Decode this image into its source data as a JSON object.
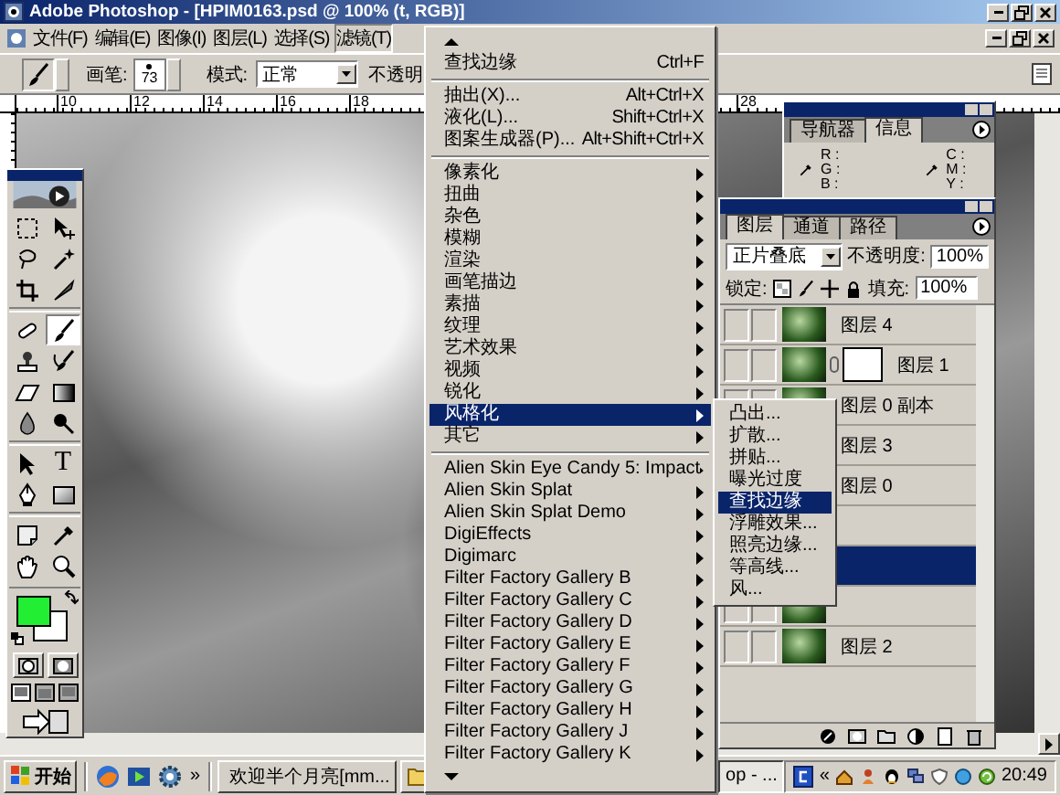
{
  "window": {
    "title": "Adobe Photoshop - [HPIM0163.psd @ 100% (t, RGB)]"
  },
  "menu_bar": [
    {
      "label": "文件(F)",
      "selected": false
    },
    {
      "label": "编辑(E)",
      "selected": false
    },
    {
      "label": "图像(I)",
      "selected": false
    },
    {
      "label": "图层(L)",
      "selected": false
    },
    {
      "label": "选择(S)",
      "selected": false
    },
    {
      "label": "滤镜(T)",
      "selected": true
    }
  ],
  "options_bar": {
    "brush_label": "画笔:",
    "brush_size": "73",
    "mode_label": "模式:",
    "mode_value": "正常",
    "opacity_label": "不透明"
  },
  "ruler": {
    "marks": [
      "10",
      "12",
      "14",
      "16",
      "18"
    ],
    "marks_after_menu": [
      "28"
    ]
  },
  "toolbox": {
    "tools": [
      {
        "kind": "marquee",
        "selected": false
      },
      {
        "kind": "move",
        "selected": false
      },
      {
        "kind": "lasso",
        "selected": false
      },
      {
        "kind": "wand",
        "selected": false
      },
      {
        "kind": "crop",
        "selected": false
      },
      {
        "kind": "slice",
        "selected": false
      },
      {
        "kind": "separator"
      },
      {
        "kind": "healing",
        "selected": false
      },
      {
        "kind": "brush",
        "selected": true
      },
      {
        "kind": "stamp",
        "selected": false
      },
      {
        "kind": "history_brush",
        "selected": false
      },
      {
        "kind": "eraser",
        "selected": false
      },
      {
        "kind": "gradient",
        "selected": false
      },
      {
        "kind": "blur",
        "selected": false
      },
      {
        "kind": "dodge",
        "selected": false
      },
      {
        "kind": "separator"
      },
      {
        "kind": "path_select",
        "selected": false
      },
      {
        "kind": "type",
        "glyph": "T",
        "selected": false
      },
      {
        "kind": "pen",
        "selected": false
      },
      {
        "kind": "shape",
        "selected": false
      },
      {
        "kind": "separator"
      },
      {
        "kind": "notes",
        "selected": false
      },
      {
        "kind": "eyedropper",
        "selected": false
      },
      {
        "kind": "hand",
        "selected": false
      },
      {
        "kind": "zoom",
        "selected": false
      }
    ],
    "swatches": [
      {
        "kind": "foreground",
        "color": "#22ee33"
      },
      {
        "kind": "background",
        "color": "#ffffff"
      }
    ]
  },
  "filter_menu": {
    "items": [
      {
        "kind": "scroll_up"
      },
      {
        "kind": "item",
        "label": "查找边缘",
        "shortcut": "Ctrl+F",
        "selected": false
      },
      {
        "kind": "separator"
      },
      {
        "kind": "item",
        "label": "抽出(X)...",
        "shortcut": "Alt+Ctrl+X",
        "selected": false
      },
      {
        "kind": "item",
        "label": "液化(L)...",
        "shortcut": "Shift+Ctrl+X",
        "selected": false
      },
      {
        "kind": "item",
        "label": "图案生成器(P)...",
        "shortcut": "Alt+Shift+Ctrl+X",
        "selected": false
      },
      {
        "kind": "separator"
      },
      {
        "kind": "submenu",
        "label": "像素化",
        "selected": false
      },
      {
        "kind": "submenu",
        "label": "扭曲",
        "selected": false
      },
      {
        "kind": "submenu",
        "label": "杂色",
        "selected": false
      },
      {
        "kind": "submenu",
        "label": "模糊",
        "selected": false
      },
      {
        "kind": "submenu",
        "label": "渲染",
        "selected": false
      },
      {
        "kind": "submenu",
        "label": "画笔描边",
        "selected": false
      },
      {
        "kind": "submenu",
        "label": "素描",
        "selected": false
      },
      {
        "kind": "submenu",
        "label": "纹理",
        "selected": false
      },
      {
        "kind": "submenu",
        "label": "艺术效果",
        "selected": false
      },
      {
        "kind": "submenu",
        "label": "视频",
        "selected": false
      },
      {
        "kind": "submenu",
        "label": "锐化",
        "selected": false
      },
      {
        "kind": "submenu",
        "label": "风格化",
        "selected": true
      },
      {
        "kind": "submenu",
        "label": "其它",
        "selected": false
      },
      {
        "kind": "separator"
      },
      {
        "kind": "submenu",
        "label": "Alien Skin Eye Candy 5: Impact",
        "selected": false
      },
      {
        "kind": "submenu",
        "label": "Alien Skin Splat",
        "selected": false
      },
      {
        "kind": "submenu",
        "label": "Alien Skin Splat Demo",
        "selected": false
      },
      {
        "kind": "submenu",
        "label": "DigiEffects",
        "selected": false
      },
      {
        "kind": "submenu",
        "label": "Digimarc",
        "selected": false
      },
      {
        "kind": "submenu",
        "label": "Filter Factory Gallery B",
        "selected": false
      },
      {
        "kind": "submenu",
        "label": "Filter Factory Gallery C",
        "selected": false
      },
      {
        "kind": "submenu",
        "label": "Filter Factory Gallery D",
        "selected": false
      },
      {
        "kind": "submenu",
        "label": "Filter Factory Gallery E",
        "selected": false
      },
      {
        "kind": "submenu",
        "label": "Filter Factory Gallery F",
        "selected": false
      },
      {
        "kind": "submenu",
        "label": "Filter Factory Gallery G",
        "selected": false
      },
      {
        "kind": "submenu",
        "label": "Filter Factory Gallery H",
        "selected": false
      },
      {
        "kind": "submenu",
        "label": "Filter Factory Gallery J",
        "selected": false
      },
      {
        "kind": "submenu",
        "label": "Filter Factory Gallery K",
        "selected": false
      },
      {
        "kind": "scroll_down"
      }
    ]
  },
  "stylize_submenu": {
    "items": [
      {
        "label": "凸出...",
        "selected": false
      },
      {
        "label": "扩散...",
        "selected": false
      },
      {
        "label": "拼贴...",
        "selected": false
      },
      {
        "label": "曝光过度",
        "selected": false
      },
      {
        "label": "查找边缘",
        "selected": true
      },
      {
        "label": "浮雕效果...",
        "selected": false
      },
      {
        "label": "照亮边缘...",
        "selected": false
      },
      {
        "label": "等高线...",
        "selected": false
      },
      {
        "label": "风...",
        "selected": false
      }
    ]
  },
  "info_panel": {
    "tabs": [
      {
        "label": "导航器",
        "selected": false
      },
      {
        "label": "信息",
        "selected": true
      }
    ],
    "rgb_readouts": [
      "R :",
      "G :",
      "B :"
    ],
    "cmyk_readouts": [
      "C :",
      "M :",
      "Y :"
    ]
  },
  "layers_panel": {
    "tabs": [
      {
        "label": "图层",
        "selected": true
      },
      {
        "label": "通道",
        "selected": false
      },
      {
        "label": "路径",
        "selected": false
      }
    ],
    "blend_mode": "正片叠底",
    "opacity_label": "不透明度:",
    "opacity_value": "100%",
    "lock_label": "锁定:",
    "fill_label": "填充:",
    "fill_value": "100%",
    "layers": [
      {
        "name": "图层 4",
        "selected": false,
        "has_mask": false
      },
      {
        "name": "图层 1",
        "selected": false,
        "has_mask": true
      },
      {
        "name": "图层 0 副本",
        "selected": false,
        "has_mask": false
      },
      {
        "name": "图层 3",
        "selected": false,
        "has_mask": false
      },
      {
        "name": "图层 0",
        "selected": false,
        "has_mask": false
      },
      {
        "selected": false,
        "has_mask": false
      },
      {
        "selected": true,
        "has_mask": false
      },
      {
        "selected": false,
        "has_mask": false
      },
      {
        "name": "图层 2",
        "selected": false,
        "has_mask": false
      }
    ]
  },
  "taskbar": {
    "start_label": "开始",
    "quick_launch_more": "»",
    "tasks": [
      {
        "kind": "web",
        "label": "欢迎半个月亮[mm..."
      },
      {
        "kind": "folder"
      },
      {
        "kind": "app",
        "label": "op - ..."
      }
    ],
    "tray_toggle": "«",
    "clock": "20:49"
  }
}
